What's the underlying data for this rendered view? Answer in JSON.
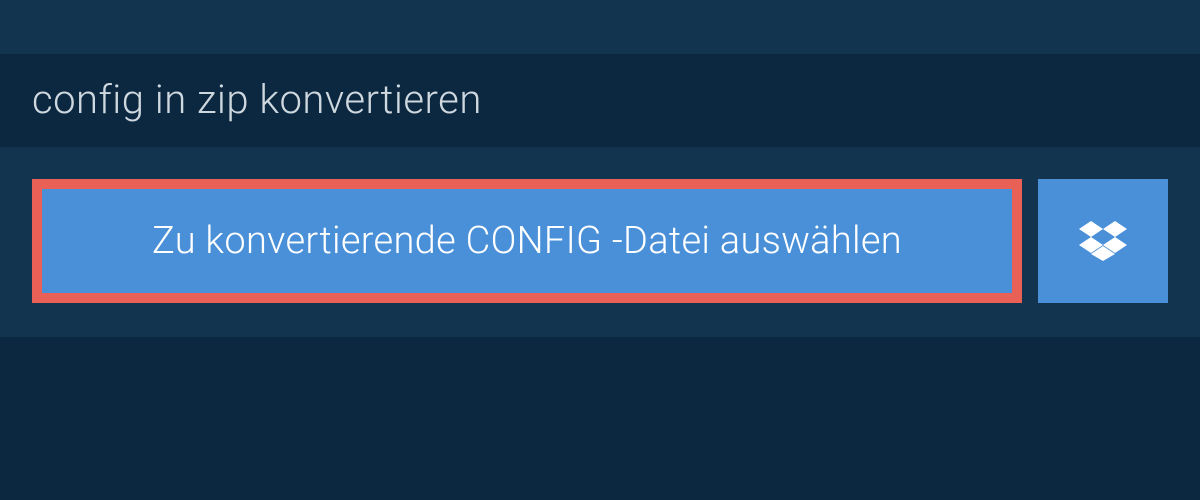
{
  "header": {
    "title": "config in zip konvertieren"
  },
  "main": {
    "select_button_label": "Zu konvertierende CONFIG -Datei auswählen",
    "dropbox_icon": "dropbox-icon"
  },
  "colors": {
    "bg_dark": "#0c2840",
    "bg_panel": "#12344f",
    "button_blue": "#4990d8",
    "highlight_border": "#e86056",
    "text_light": "#cfd8df"
  }
}
